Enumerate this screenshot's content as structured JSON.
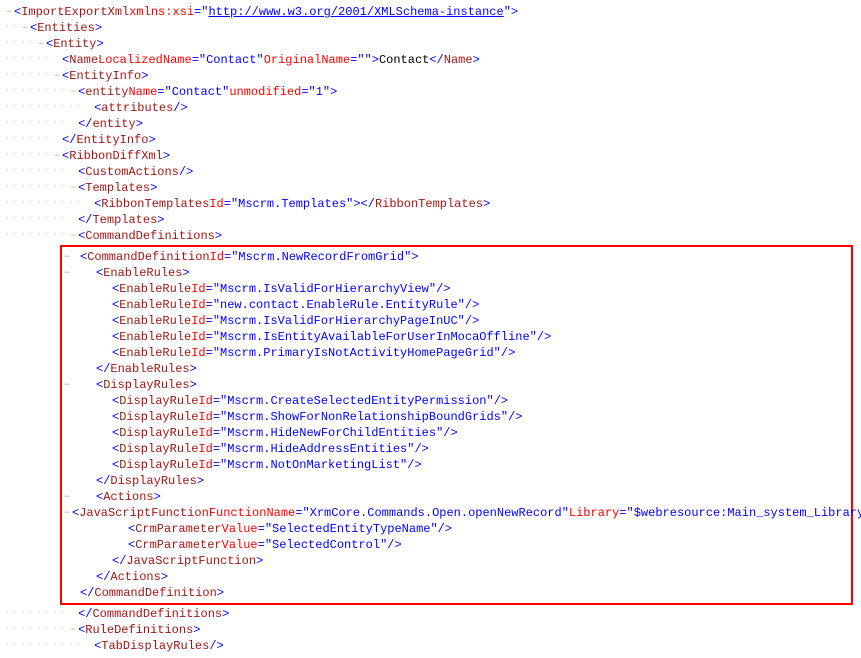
{
  "xml": {
    "root": "ImportExportXml",
    "ns_attr": "xmlns:xsi",
    "ns_url": "http://www.w3.org/2001/XMLSchema-instance",
    "entities": "Entities",
    "entity": "Entity",
    "name_tag": "Name",
    "name_attrs": {
      "LocalizedName": "Contact",
      "OriginalName": ""
    },
    "name_text": "Contact",
    "entityinfo": "EntityInfo",
    "entity_lc": "entity",
    "entity_lc_attrs": {
      "Name": "Contact",
      "unmodified": "1"
    },
    "attributes": "attributes",
    "ribbondiffxml": "RibbonDiffXml",
    "customactions": "CustomActions",
    "templates": "Templates",
    "ribbontemplates": "RibbonTemplates",
    "ribbontemplates_id": "Mscrm.Templates",
    "commanddefinitions": "CommandDefinitions",
    "commanddefinition": "CommandDefinition",
    "commanddefinition_id": "Mscrm.NewRecordFromGrid",
    "enablerules": "EnableRules",
    "enablerule": "EnableRule",
    "enablerule_ids": [
      "Mscrm.IsValidForHierarchyView",
      "new.contact.EnableRule.EntityRule",
      "Mscrm.IsValidForHierarchyPageInUC",
      "Mscrm.IsEntityAvailableForUserInMocaOffline",
      "Mscrm.PrimaryIsNotActivityHomePageGrid"
    ],
    "displayrules": "DisplayRules",
    "displayrule": "DisplayRule",
    "displayrule_ids": [
      "Mscrm.CreateSelectedEntityPermission",
      "Mscrm.ShowForNonRelationshipBoundGrids",
      "Mscrm.HideNewForChildEntities",
      "Mscrm.HideAddressEntities",
      "Mscrm.NotOnMarketingList"
    ],
    "actions": "Actions",
    "jsfunc": "JavaScriptFunction",
    "jsfunc_attrs": {
      "FunctionName": "XrmCore.Commands.Open.openNewRecord",
      "Library": "$webresource:Main_system_Library.js"
    },
    "crmparam": "CrmParameter",
    "crmparam_values": [
      "SelectedEntityTypeName",
      "SelectedControl"
    ],
    "ruledefinitions": "RuleDefinitions",
    "tabdisplayrules": "TabDisplayRules",
    "id_attr": "Id",
    "value_attr": "Value"
  }
}
